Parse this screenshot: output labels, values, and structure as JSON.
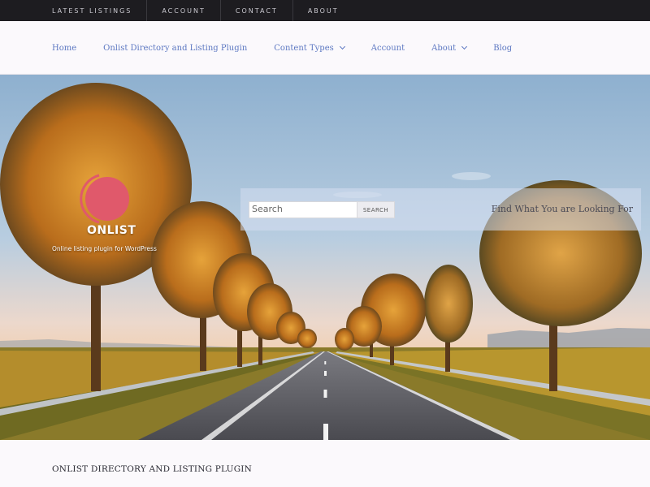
{
  "topbar": {
    "items": [
      {
        "label": "LATEST LISTINGS"
      },
      {
        "label": "ACCOUNT"
      },
      {
        "label": "CONTACT"
      },
      {
        "label": "ABOUT"
      }
    ]
  },
  "mainnav": {
    "items": [
      {
        "label": "Home"
      },
      {
        "label": "Onlist Directory and Listing Plugin"
      },
      {
        "label": "Content Types"
      },
      {
        "label": "Account"
      },
      {
        "label": "About"
      },
      {
        "label": "Blog"
      }
    ]
  },
  "hero": {
    "site_title": "ONLIST",
    "tagline": "Online listing plugin for WordPress",
    "logo_color": "#e0596b",
    "search": {
      "value": "Search",
      "button_label": "SEARCH",
      "prompt": "Find What You are Looking For"
    }
  },
  "page": {
    "heading": "ONLIST DIRECTORY AND LISTING PLUGIN"
  },
  "colors": {
    "topbar_bg": "#1d1c20",
    "nav_link": "#5d78c2",
    "accent": "#e0596b"
  }
}
